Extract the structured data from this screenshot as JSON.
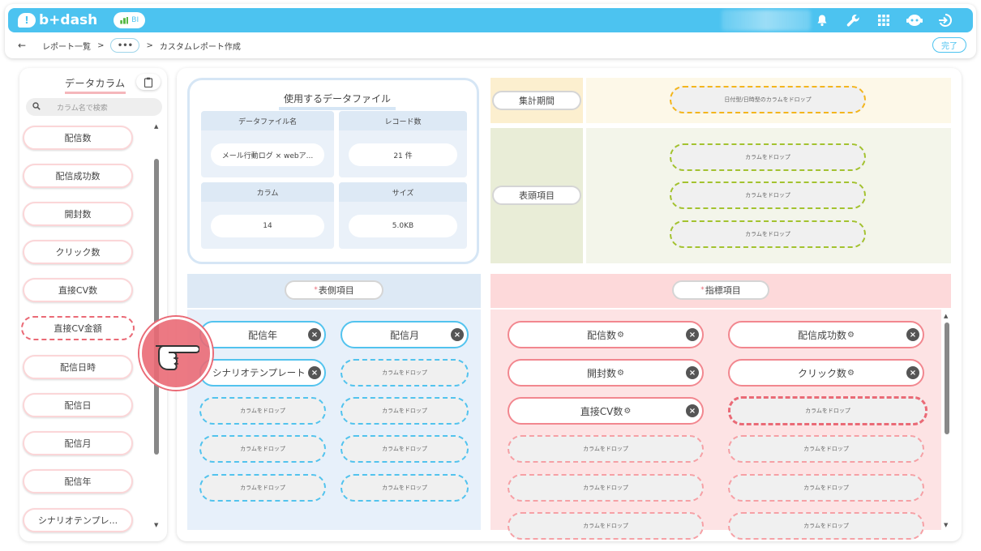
{
  "app": {
    "logo_text": "b+dash",
    "logo_mark": "!",
    "bi_badge": "BI"
  },
  "breadcrumb": {
    "back": "←",
    "report_list": "レポート一覧",
    "sep1": ">",
    "dots": "•••",
    "sep2": ">",
    "current": "カスタムレポート作成"
  },
  "done_button": "完了",
  "left_panel": {
    "title": "データカラム",
    "search_placeholder": "カラム名で検索",
    "items": [
      "配信数",
      "配信成功数",
      "開封数",
      "クリック数",
      "直接CV数",
      "直接CV金額",
      "配信日時",
      "配信日",
      "配信月",
      "配信年",
      "シナリオテンプレ..."
    ],
    "dragging_index": 5
  },
  "data_file": {
    "title": "使用するデータファイル",
    "file_name_label": "データファイル名",
    "file_name_value": "メール行動ログ × webア...",
    "record_label": "レコード数",
    "record_value": "21 件",
    "column_label": "カラム",
    "column_value": "14",
    "size_label": "サイズ",
    "size_value": "5.0KB"
  },
  "period": {
    "label": "集計期間",
    "drop_hint": "日付型/日時型のカラムをドロップ"
  },
  "header_items": {
    "label": "表頭項目",
    "drop_hint": "カラムをドロップ"
  },
  "row_items": {
    "required_mark": "*",
    "label": "表側項目",
    "chips": [
      "配信年",
      "配信月",
      "シナリオテンプレート"
    ],
    "drop_hint": "カラムをドロップ"
  },
  "metric_items": {
    "required_mark": "*",
    "label": "指標項目",
    "chips": [
      "配信数",
      "配信成功数",
      "開封数",
      "クリック数",
      "直接CV数"
    ],
    "drop_hint": "カラムをドロップ"
  },
  "glyphs": {
    "close": "×",
    "gear": "⚙",
    "scroll_up": "▲",
    "scroll_down": "▼",
    "search": "🔍",
    "clipboard": "📋"
  },
  "colors": {
    "brand": "#4cc3f0",
    "pink_accent": "#ea6a76",
    "blue_slot": "#52c3ee",
    "yellow_slot": "#f3b51d",
    "green_slot": "#a3c22f"
  }
}
